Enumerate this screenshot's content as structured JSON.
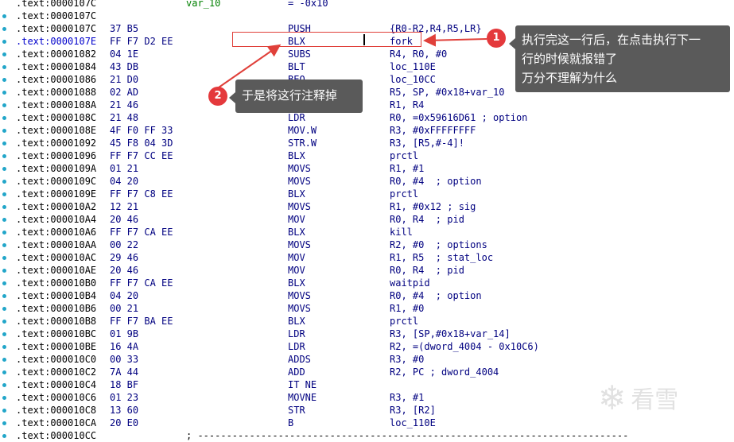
{
  "rows": [
    {
      "addr": ".text:0000107C",
      "type": "var",
      "varname": "var_10",
      "varval": "= -0x10"
    },
    {
      "addr": ".text:0000107C",
      "type": "blank"
    },
    {
      "addr": ".text:0000107C",
      "bytes": "37 B5",
      "mnem": "PUSH",
      "op": "{R0-R2,R4,R5,LR}"
    },
    {
      "addr": ".text:0000107E",
      "bytes": "FF F7 D2 EE",
      "mnem": "BLX",
      "op": "fork",
      "highlight": true
    },
    {
      "addr": ".text:00001082",
      "bytes": "04 1E",
      "mnem": "SUBS",
      "op": "R4, R0, #0"
    },
    {
      "addr": ".text:00001084",
      "bytes": "43 DB",
      "mnem": "BLT",
      "op": "loc_110E"
    },
    {
      "addr": ".text:00001086",
      "bytes": "21 D0",
      "mnem": "BEQ",
      "op": "loc_10CC"
    },
    {
      "addr": ".text:00001088",
      "bytes": "02 AD",
      "mnem": "ADD",
      "op": "R5, SP, #0x18+var_10"
    },
    {
      "addr": ".text:0000108A",
      "bytes": "21 46",
      "mnem": "MOV",
      "op": "R1, R4"
    },
    {
      "addr": ".text:0000108C",
      "bytes": "21 48",
      "mnem": "LDR",
      "op": "R0, =0x59616D61 ; option"
    },
    {
      "addr": ".text:0000108E",
      "bytes": "4F F0 FF 33",
      "mnem": "MOV.W",
      "op": "R3, #0xFFFFFFFF"
    },
    {
      "addr": ".text:00001092",
      "bytes": "45 F8 04 3D",
      "mnem": "STR.W",
      "op": "R3, [R5,#-4]!"
    },
    {
      "addr": ".text:00001096",
      "bytes": "FF F7 CC EE",
      "mnem": "BLX",
      "op": "prctl"
    },
    {
      "addr": ".text:0000109A",
      "bytes": "01 21",
      "mnem": "MOVS",
      "op": "R1, #1"
    },
    {
      "addr": ".text:0000109C",
      "bytes": "04 20",
      "mnem": "MOVS",
      "op": "R0, #4  ; option"
    },
    {
      "addr": ".text:0000109E",
      "bytes": "FF F7 C8 EE",
      "mnem": "BLX",
      "op": "prctl"
    },
    {
      "addr": ".text:000010A2",
      "bytes": "12 21",
      "mnem": "MOVS",
      "op": "R1, #0x12 ; sig"
    },
    {
      "addr": ".text:000010A4",
      "bytes": "20 46",
      "mnem": "MOV",
      "op": "R0, R4  ; pid"
    },
    {
      "addr": ".text:000010A6",
      "bytes": "FF F7 CA EE",
      "mnem": "BLX",
      "op": "kill"
    },
    {
      "addr": ".text:000010AA",
      "bytes": "00 22",
      "mnem": "MOVS",
      "op": "R2, #0  ; options"
    },
    {
      "addr": ".text:000010AC",
      "bytes": "29 46",
      "mnem": "MOV",
      "op": "R1, R5  ; stat_loc"
    },
    {
      "addr": ".text:000010AE",
      "bytes": "20 46",
      "mnem": "MOV",
      "op": "R0, R4  ; pid"
    },
    {
      "addr": ".text:000010B0",
      "bytes": "FF F7 CA EE",
      "mnem": "BLX",
      "op": "waitpid"
    },
    {
      "addr": ".text:000010B4",
      "bytes": "04 20",
      "mnem": "MOVS",
      "op": "R0, #4  ; option"
    },
    {
      "addr": ".text:000010B6",
      "bytes": "00 21",
      "mnem": "MOVS",
      "op": "R1, #0"
    },
    {
      "addr": ".text:000010B8",
      "bytes": "FF F7 BA EE",
      "mnem": "BLX",
      "op": "prctl"
    },
    {
      "addr": ".text:000010BC",
      "bytes": "01 9B",
      "mnem": "LDR",
      "op": "R3, [SP,#0x18+var_14]"
    },
    {
      "addr": ".text:000010BE",
      "bytes": "16 4A",
      "mnem": "LDR",
      "op": "R2, =(dword_4004 - 0x10C6)"
    },
    {
      "addr": ".text:000010C0",
      "bytes": "00 33",
      "mnem": "ADDS",
      "op": "R3, #0"
    },
    {
      "addr": ".text:000010C2",
      "bytes": "7A 44",
      "mnem": "ADD",
      "op": "R2, PC ; dword_4004"
    },
    {
      "addr": ".text:000010C4",
      "bytes": "18 BF",
      "mnem": "IT NE",
      "op": ""
    },
    {
      "addr": ".text:000010C6",
      "bytes": "01 23",
      "mnem": "MOVNE",
      "op": "R3, #1"
    },
    {
      "addr": ".text:000010C8",
      "bytes": "13 60",
      "mnem": "STR",
      "op": "R3, [R2]"
    },
    {
      "addr": ".text:000010CA",
      "bytes": "20 E0",
      "mnem": "B",
      "op": "loc_110E"
    },
    {
      "addr": ".text:000010CC",
      "type": "sep",
      "sep": "; ---------------------------------------------------------------------------"
    }
  ],
  "annotations": {
    "badge1": "1",
    "tip1_line1": "执行完这一行后，在点击执行下一",
    "tip1_line2": "行的时候就报错了",
    "tip1_line3": "万分不理解为什么",
    "badge2": "2",
    "tip2": "于是将这行注释掉"
  },
  "watermark": {
    "icon": "snowflake-icon",
    "text": "看雪"
  },
  "colors": {
    "highlight_box": "#e0403a",
    "badge": "#e4393c",
    "tooltip": "#5a5a5a",
    "gutter_dot": "#22a6c9"
  }
}
